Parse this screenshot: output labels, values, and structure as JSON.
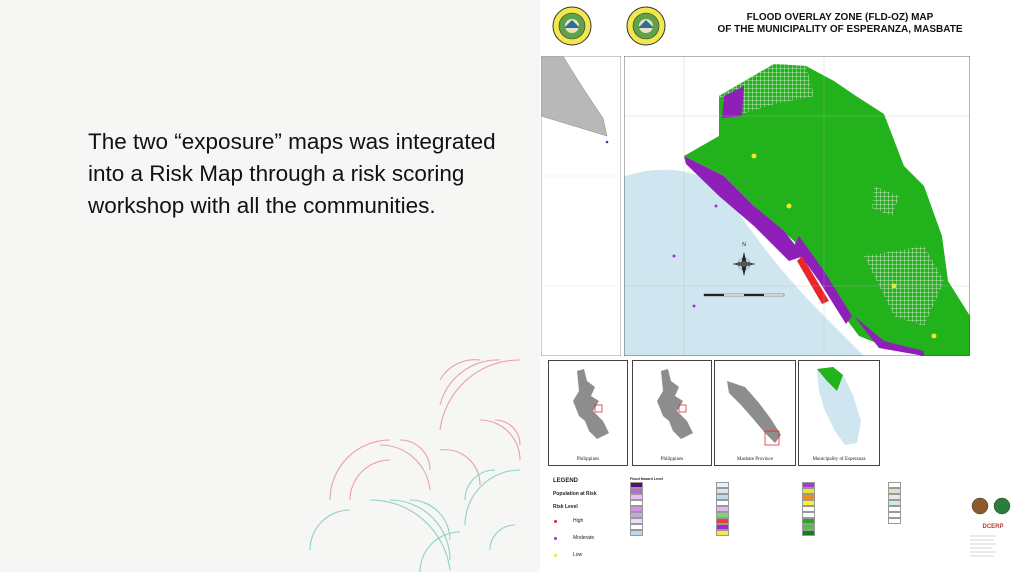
{
  "slide": {
    "body_text": "The two “exposure” maps was integrated into a Risk Map through a risk scoring workshop with all the communities."
  },
  "map": {
    "title_line1": "FLOOD OVERLAY ZONE (FLD-OZ) MAP",
    "title_line2": "OF THE MUNICIPALITY OF ESPERANZA, MASBATE",
    "north_arrow_label": "N",
    "inset_labels": [
      "Philippines",
      "Philippines",
      "Masbate Province",
      "Municipality of Esperanza"
    ],
    "logo_text": "DCERP",
    "colors": {
      "land_green": "#22b21c",
      "sea_blue": "#cfe6f0",
      "flood_purple": "#8e1fb8",
      "high_risk_red": "#e8272d",
      "moderate_risk_purple": "#9b35d6",
      "low_risk_yellow": "#f0e81f",
      "inset_gray": "#8d8d8d"
    }
  },
  "legend": {
    "title": "LEGEND",
    "population_heading": "Population at Risk",
    "risk_level_heading": "Risk Level",
    "items": [
      {
        "label": "High",
        "color": "#e8272d"
      },
      {
        "label": "Moderate",
        "color": "#9b35d6"
      },
      {
        "label": "Low",
        "color": "#f0e81f"
      }
    ]
  },
  "key_columns": [
    {
      "heading": "Flood Hazard Level",
      "rows": [
        {
          "color": "#5a0f78"
        },
        {
          "color": "#b66ad6"
        },
        {
          "color": "#e3c3f1"
        },
        {
          "color": "#ffffff"
        },
        {
          "color": "#d68ee8"
        },
        {
          "color": "#c9a3e2"
        },
        {
          "color": "#ecdcf5"
        },
        {
          "color": "#ffffff"
        },
        {
          "color": "#bcd8ee"
        }
      ]
    },
    {
      "heading": "",
      "rows": [
        {
          "color": "#eaf3f9"
        },
        {
          "color": "#d5e6f1"
        },
        {
          "color": "#c0d9ea"
        },
        {
          "color": "#ffffff"
        },
        {
          "color": "#e3b6f0"
        },
        {
          "color": "#7fd17a"
        },
        {
          "color": "#ee3b3b"
        },
        {
          "color": "#9e2ac9"
        },
        {
          "color": "#f3e84a"
        }
      ]
    },
    {
      "heading": "",
      "rows": [
        {
          "color": "#a83ad2"
        },
        {
          "color": "#f0e12a"
        },
        {
          "color": "#ef8a1f"
        },
        {
          "color": "#f6f03b"
        },
        {
          "color": "#fafafa"
        },
        {
          "color": "#ffffff"
        },
        {
          "color": "#2da32b"
        },
        {
          "color": "#4fc24b"
        },
        {
          "color": "#137f15"
        }
      ]
    },
    {
      "heading": "",
      "rows": [
        {
          "color": "#ffffff"
        },
        {
          "color": "#cfe9c8"
        },
        {
          "color": "#e8e8e8"
        },
        {
          "color": "#cfe6f0"
        },
        {
          "color": "#ffffff"
        },
        {
          "color": "#ffffff"
        },
        {
          "color": "#ffffff"
        }
      ]
    }
  ]
}
